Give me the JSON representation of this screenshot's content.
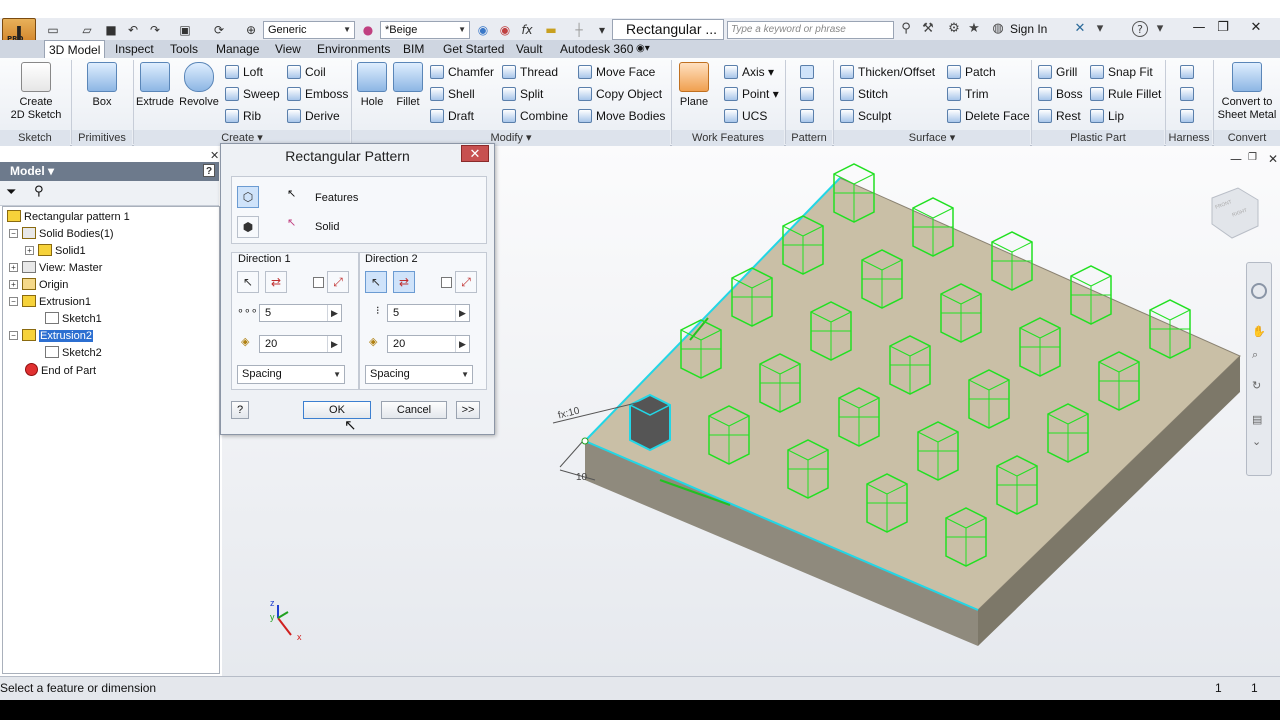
{
  "app_logo_text": "I",
  "app_logo_sub": "PRO",
  "quick_access": {
    "material": "Generic",
    "appearance": "*Beige",
    "fx": "fx"
  },
  "document_tab": "Rectangular ...",
  "search_placeholder": "Type a keyword or phrase",
  "sign_in": "Sign In",
  "help": "?",
  "window": {
    "minimize": "—",
    "restore": "❐",
    "close": "✕"
  },
  "tabs": [
    "3D Model",
    "Inspect",
    "Tools",
    "Manage",
    "View",
    "Environments",
    "BIM",
    "Get Started",
    "Vault",
    "Autodesk 360"
  ],
  "ribbon": {
    "create_sketch": "Create\n2D Sketch",
    "box": "Box",
    "extrude": "Extrude",
    "revolve": "Revolve",
    "loft": "Loft",
    "sweep": "Sweep",
    "rib": "Rib",
    "coil": "Coil",
    "emboss": "Emboss",
    "derive": "Derive",
    "hole": "Hole",
    "fillet": "Fillet",
    "chamfer": "Chamfer",
    "shell": "Shell",
    "draft": "Draft",
    "thread": "Thread",
    "split": "Split",
    "combine": "Combine",
    "move_face": "Move Face",
    "copy_object": "Copy Object",
    "move_bodies": "Move Bodies",
    "plane": "Plane",
    "axis": "Axis",
    "point": "Point",
    "ucs": "UCS",
    "thicken": "Thicken/Offset",
    "stitch": "Stitch",
    "sculpt": "Sculpt",
    "patch": "Patch",
    "trim": "Trim",
    "delete_face": "Delete Face",
    "grill": "Grill",
    "boss": "Boss",
    "rest": "Rest",
    "snap_fit": "Snap Fit",
    "rule_fillet": "Rule Fillet",
    "lip": "Lip",
    "convert": "Convert to\nSheet Metal",
    "groups": {
      "sketch": "Sketch",
      "primitives": "Primitives",
      "create": "Create ▾",
      "modify": "Modify ▾",
      "work_features": "Work Features",
      "pattern": "Pattern",
      "surface": "Surface ▾",
      "plastic_part": "Plastic Part",
      "harness": "Harness",
      "convert": "Convert"
    }
  },
  "browser": {
    "header": "Model ▾",
    "tree": [
      "Rectangular pattern 1",
      "Solid Bodies(1)",
      "Solid1",
      "View: Master",
      "Origin",
      "Extrusion1",
      "Sketch1",
      "Extrusion2",
      "Sketch2",
      "End of Part"
    ]
  },
  "dialog": {
    "title": "Rectangular Pattern",
    "close": "✕",
    "features": "Features",
    "solid": "Solid",
    "direction1": {
      "label": "Direction 1",
      "count": "5",
      "spacing": "20",
      "method": "Spacing"
    },
    "direction2": {
      "label": "Direction 2",
      "count": "5",
      "spacing": "20",
      "method": "Spacing"
    },
    "help": "?",
    "ok": "OK",
    "cancel": "Cancel",
    "more": ">>"
  },
  "viewport": {
    "dim1": "fx:10",
    "dim2": "10",
    "viewcube_front": "FRONT",
    "viewcube_right": "RIGHT"
  },
  "status": {
    "message": "Select a feature or dimension",
    "count1": "1",
    "count2": "1"
  },
  "colors": {
    "preview_green": "#22e022",
    "selected_cyan": "#22d6e6",
    "part_top": "#c9bfa6",
    "part_side": "#8f8a7d"
  }
}
